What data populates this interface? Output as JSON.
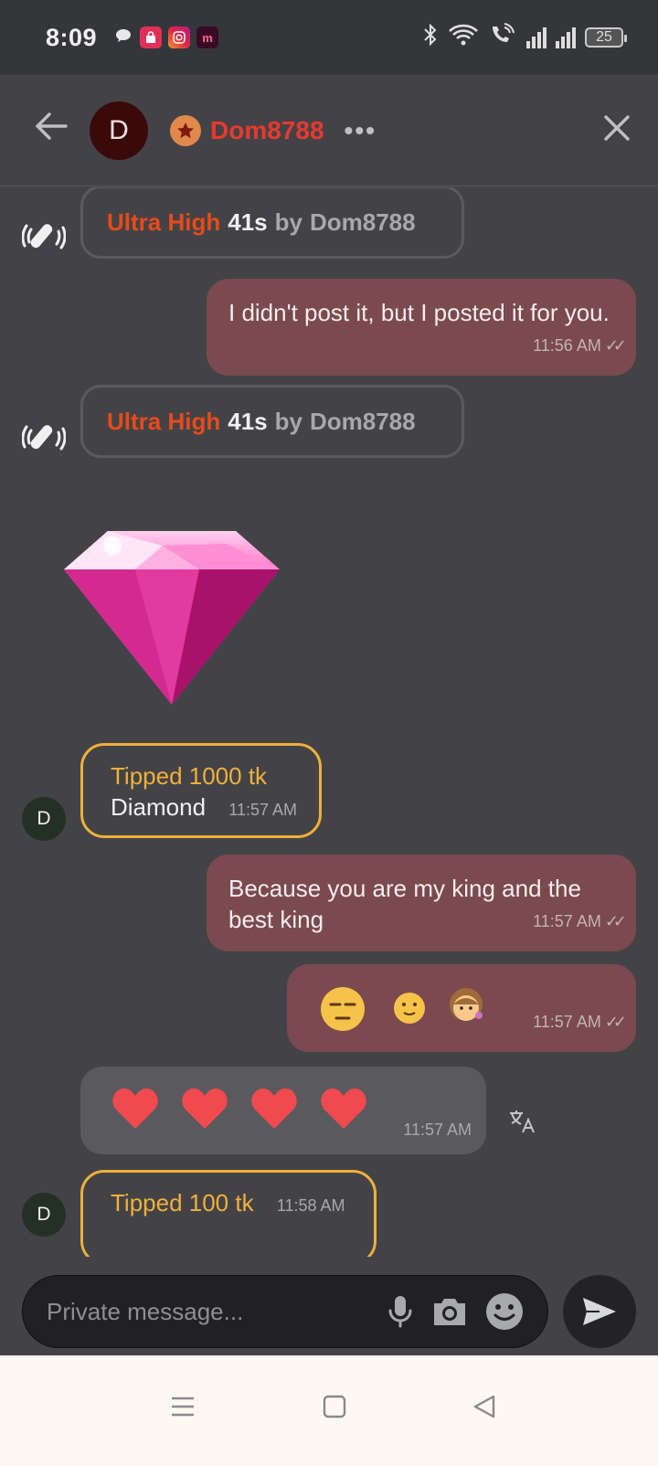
{
  "status_bar": {
    "time": "8:09",
    "battery": "25"
  },
  "header": {
    "avatar_letter": "D",
    "username": "Dom8788",
    "more": "•••"
  },
  "system_messages": [
    {
      "level": "Ultra High",
      "duration": "41s",
      "by": "by",
      "user": "Dom8788"
    },
    {
      "level": "Ultra High",
      "duration": "41s",
      "by": "by",
      "user": "Dom8788"
    }
  ],
  "messages": {
    "out1": {
      "text": "I didn't post it, but I posted it for you.",
      "time": "11:56 AM"
    },
    "tip1": {
      "title": "Tipped 1000 tk",
      "gift": "Diamond",
      "time": "11:57 AM",
      "avatar": "D"
    },
    "out2": {
      "text": "Because you are my king and the best king",
      "time": "11:57 AM"
    },
    "out3": {
      "emojis": "😒 🙂 👧",
      "time": "11:57 AM"
    },
    "in1": {
      "time": "11:57 AM"
    },
    "tip2": {
      "title": "Tipped 100 tk",
      "time": "11:58 AM",
      "avatar": "D"
    }
  },
  "input": {
    "placeholder": "Private message..."
  },
  "colors": {
    "accent_red": "#e8392e",
    "tip_gold": "#f0b03a",
    "outgoing_bubble": "#7a4a4e",
    "background": "#434347"
  },
  "icons": [
    "back-arrow-icon",
    "close-icon",
    "vibration-icon",
    "diamond-icon",
    "heart-icon",
    "translate-icon",
    "mic-icon",
    "camera-icon",
    "emoji-icon",
    "send-icon"
  ]
}
